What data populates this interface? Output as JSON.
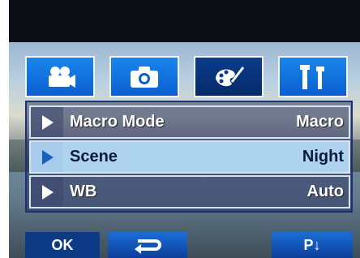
{
  "tabs": [
    {
      "name": "video-camera-icon",
      "active": false
    },
    {
      "name": "camera-icon",
      "active": false
    },
    {
      "name": "palette-icon",
      "active": true
    },
    {
      "name": "settings-tools-icon",
      "active": false
    }
  ],
  "menu": {
    "rows": [
      {
        "label": "Macro Mode",
        "value": "Macro",
        "selected": false
      },
      {
        "label": "Scene",
        "value": "Night",
        "selected": true
      },
      {
        "label": "WB",
        "value": "Auto",
        "selected": false
      }
    ]
  },
  "buttons": {
    "ok_label": "OK",
    "back_icon": "return-arrow-icon",
    "page_label": "P↓"
  },
  "colors": {
    "tab_blue": "#1a86ec",
    "tab_active": "#0b3c8c",
    "row_selected": "#aed3ee"
  }
}
